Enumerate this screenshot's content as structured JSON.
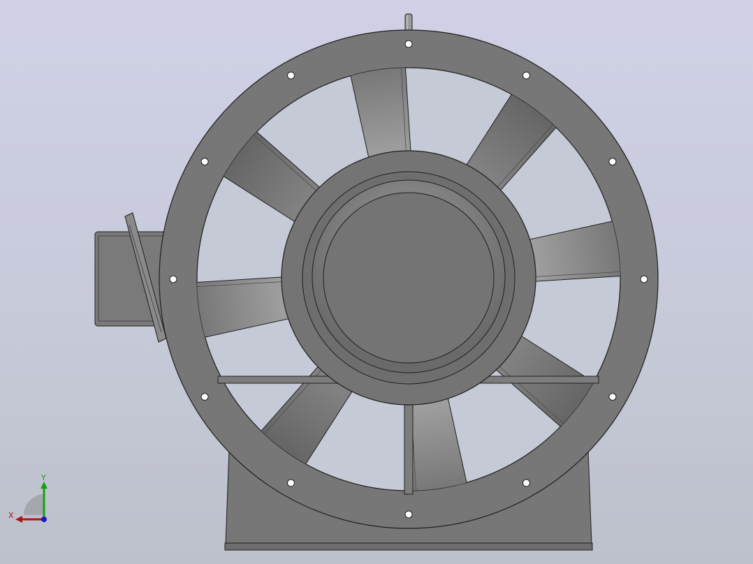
{
  "view": {
    "background_top": "#d0d1e7",
    "background_bottom": "#bdc1cb",
    "model_color": "#757575",
    "edge_color": "#1e1e1e"
  },
  "triad": {
    "x_label": "X",
    "y_label": "Y",
    "x_color": "#b01212",
    "y_color": "#12a012",
    "z_color": "#1a1ac8"
  }
}
